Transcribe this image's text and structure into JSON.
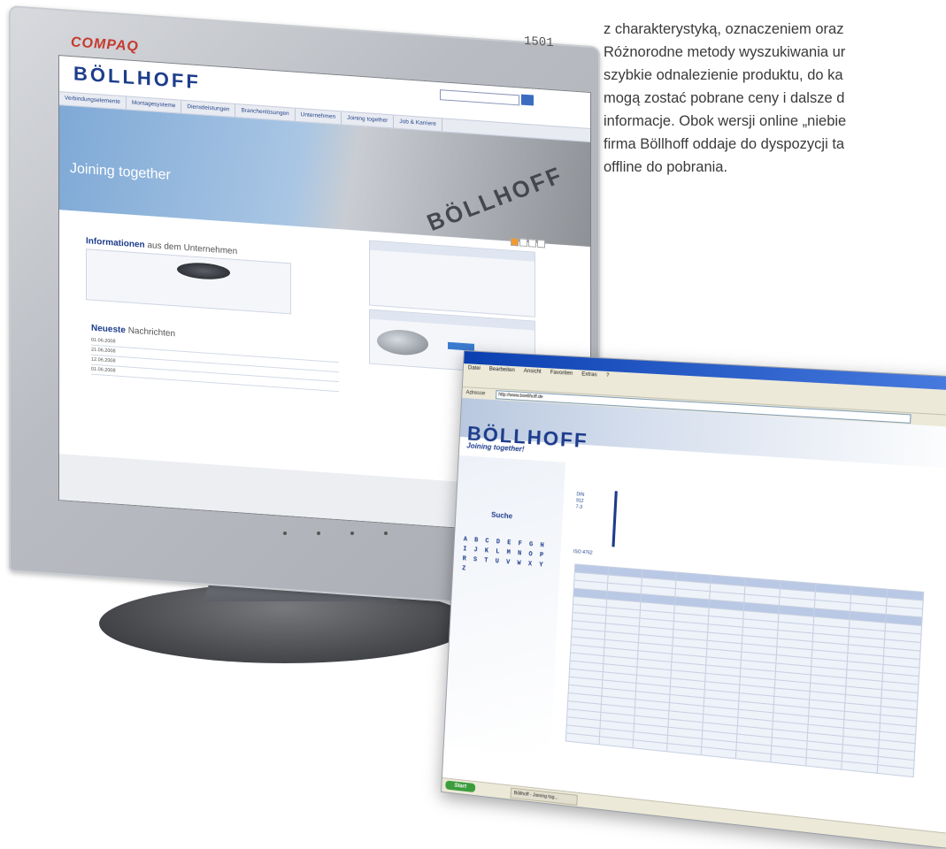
{
  "side_text": {
    "line1": "z charakterystyką, oznaczeniem oraz",
    "line2": "Różnorodne metody wyszukiwania ur",
    "line3": "szybkie odnalezienie produktu, do ka",
    "line4": "mogą zostać pobrane ceny i dalsze d",
    "line5": "informacje. Obok wersji online „niebie",
    "line6": "firma Böllhoff oddaje do dyspozycji ta",
    "line7": "offline do pobrania."
  },
  "monitor": {
    "brand": "COMPAQ",
    "model": "1501"
  },
  "website": {
    "logo": "BÖLLHOFF",
    "nav": [
      "Verbindungselemente",
      "Montagesysteme",
      "Dienstleistungen",
      "Branchenlösungen",
      "Unternehmen",
      "Joining together",
      "Job & Karriere"
    ],
    "hero_title": "Joining together",
    "hero_logo": "BÖLLHOFF",
    "section_info_title": "Informationen",
    "section_info_rest": "aus dem Unternehmen",
    "section_news_title": "Neueste",
    "section_news_rest": "Nachrichten",
    "news": [
      {
        "date": "01.06.2008",
        "text": ""
      },
      {
        "date": "21.06.2008",
        "text": ""
      },
      {
        "date": "12.06.2008",
        "text": ""
      },
      {
        "date": "01.06.2008",
        "text": ""
      }
    ]
  },
  "ie": {
    "menu": [
      "Datei",
      "Bearbeiten",
      "Ansicht",
      "Favoriten",
      "Extras",
      "?"
    ],
    "address_label": "Adresse",
    "address_value": "http://www.boellhoff.de",
    "logo": "BÖLLHOFF",
    "slogan": "Joining together!",
    "search_label": "Suche",
    "alphabet": "A B C D E F G H  I J K L M N O P  R S T U V W X Y Z",
    "iso": "ISO 4762",
    "din": "DIN\n912\n7-3",
    "start": "Start",
    "task": "Böllhoff - Joining tog..."
  },
  "colors": {
    "brand_blue": "#1d3c8c",
    "accent_orange": "#f29a2e",
    "compaq_red": "#c53a2c"
  }
}
